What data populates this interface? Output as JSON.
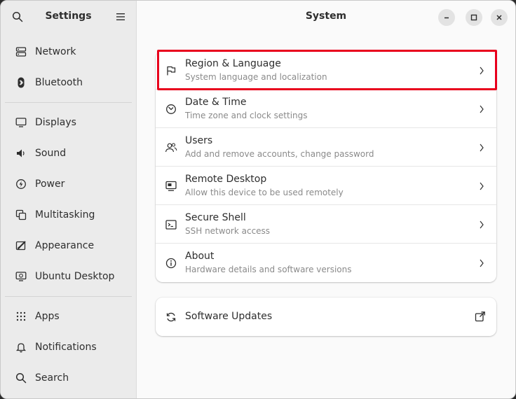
{
  "sidebar": {
    "title": "Settings",
    "groups": [
      [
        {
          "label": "Network",
          "icon": "network-icon"
        },
        {
          "label": "Bluetooth",
          "icon": "bluetooth-icon"
        }
      ],
      [
        {
          "label": "Displays",
          "icon": "display-icon"
        },
        {
          "label": "Sound",
          "icon": "sound-icon"
        },
        {
          "label": "Power",
          "icon": "power-icon"
        },
        {
          "label": "Multitasking",
          "icon": "multitasking-icon"
        },
        {
          "label": "Appearance",
          "icon": "appearance-icon"
        },
        {
          "label": "Ubuntu Desktop",
          "icon": "ubuntu-desktop-icon"
        }
      ],
      [
        {
          "label": "Apps",
          "icon": "apps-grid-icon"
        },
        {
          "label": "Notifications",
          "icon": "bell-icon"
        },
        {
          "label": "Search",
          "icon": "search-icon"
        }
      ]
    ]
  },
  "main": {
    "title": "System",
    "rows": [
      {
        "title": "Region & Language",
        "subtitle": "System language and localization",
        "icon": "flag-icon"
      },
      {
        "title": "Date & Time",
        "subtitle": "Time zone and clock settings",
        "icon": "clock-icon"
      },
      {
        "title": "Users",
        "subtitle": "Add and remove accounts, change password",
        "icon": "users-icon"
      },
      {
        "title": "Remote Desktop",
        "subtitle": "Allow this device to be used remotely",
        "icon": "remote-desktop-icon"
      },
      {
        "title": "Secure Shell",
        "subtitle": "SSH network access",
        "icon": "terminal-icon"
      },
      {
        "title": "About",
        "subtitle": "Hardware details and software versions",
        "icon": "info-icon"
      }
    ],
    "updates": {
      "title": "Software Updates",
      "icon": "refresh-icon"
    }
  },
  "colors": {
    "highlight": "#e8001c",
    "sidebar_bg": "#ebebeb",
    "main_bg": "#fafafa"
  }
}
